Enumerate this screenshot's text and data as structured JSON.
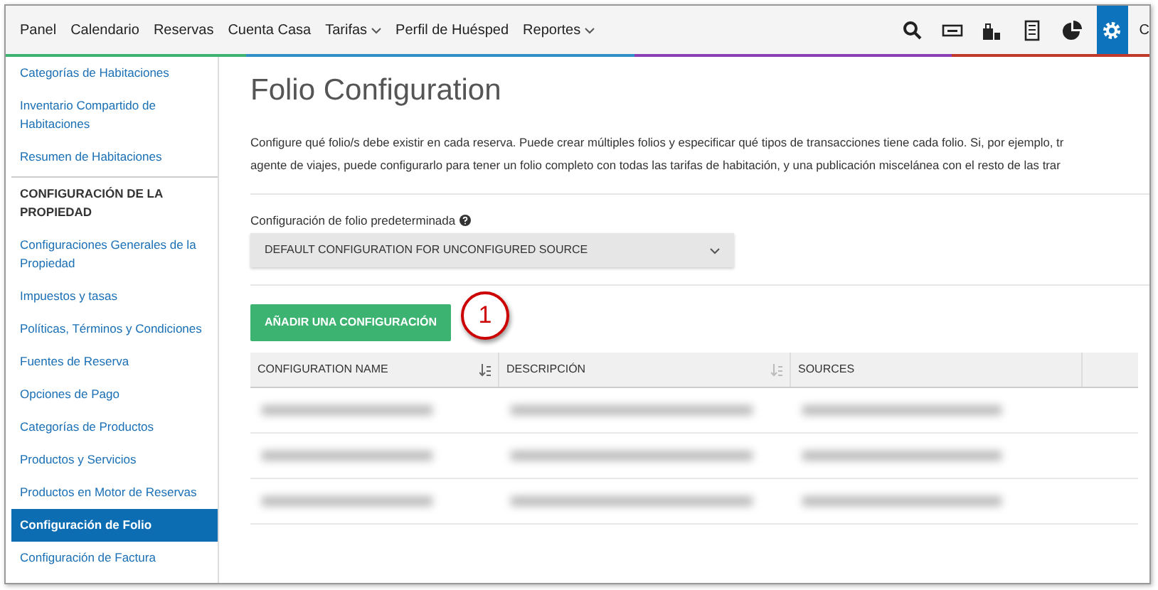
{
  "nav": {
    "items": [
      {
        "label": "Panel",
        "dropdown": false
      },
      {
        "label": "Calendario",
        "dropdown": false
      },
      {
        "label": "Reservas",
        "dropdown": false
      },
      {
        "label": "Cuenta Casa",
        "dropdown": false
      },
      {
        "label": "Tarifas",
        "dropdown": true
      },
      {
        "label": "Perfil de Huésped",
        "dropdown": false
      },
      {
        "label": "Reportes",
        "dropdown": true
      }
    ],
    "icons": [
      {
        "kind": "search",
        "selected": false
      },
      {
        "kind": "card",
        "selected": false
      },
      {
        "kind": "bag",
        "selected": false
      },
      {
        "kind": "grid",
        "selected": false
      },
      {
        "kind": "pie",
        "selected": false
      },
      {
        "kind": "gear",
        "selected": true
      }
    ],
    "cut_label": "C"
  },
  "sidebar": {
    "items": [
      {
        "label": "Categorías de Habitaciones",
        "kind": "link",
        "selected": false
      },
      {
        "label": "Inventario Compartido de Habitaciones",
        "kind": "link",
        "selected": false
      },
      {
        "label": "Resumen de Habitaciones",
        "kind": "link",
        "selected": false
      },
      {
        "label": "CONFIGURACIÓN DE LA PROPIEDAD",
        "kind": "heading",
        "selected": false
      },
      {
        "label": "Configuraciones Generales de la Propiedad",
        "kind": "link",
        "selected": false
      },
      {
        "label": "Impuestos y tasas",
        "kind": "link",
        "selected": false
      },
      {
        "label": "Políticas, Términos y Condiciones",
        "kind": "link",
        "selected": false
      },
      {
        "label": "Fuentes de Reserva",
        "kind": "link",
        "selected": false
      },
      {
        "label": "Opciones de Pago",
        "kind": "link",
        "selected": false
      },
      {
        "label": "Categorías de Productos",
        "kind": "link",
        "selected": false
      },
      {
        "label": "Productos y Servicios",
        "kind": "link",
        "selected": false
      },
      {
        "label": "Productos en Motor de Reservas",
        "kind": "link",
        "selected": false
      },
      {
        "label": "Configuración de Folio",
        "kind": "link",
        "selected": true
      },
      {
        "label": "Configuración de Factura",
        "kind": "link",
        "selected": false
      }
    ]
  },
  "main": {
    "title": "Folio Configuration",
    "description_lines": [
      "Configure qué folio/s debe existir en cada reserva. Puede crear múltiples folios y especificar qué tipos de transacciones tiene cada folio. Si, por ejemplo, tr",
      "agente de viajes, puede configurarlo para tener un folio completo con todas las tarifas de habitación, y una publicación miscelánea con el resto de las trar"
    ],
    "default_select": {
      "label": "Configuración de folio predeterminada",
      "value": "DEFAULT CONFIGURATION FOR UNCONFIGURED SOURCE"
    },
    "add_button": "AÑADIR UNA CONFIGURACIÓN",
    "callout": "1",
    "table": {
      "columns": [
        {
          "label": "CONFIGURATION NAME",
          "sortable": true
        },
        {
          "label": "DESCRIPCIÓN",
          "sortable": true
        },
        {
          "label": "SOURCES",
          "sortable": false
        }
      ],
      "rows": [
        {
          "blurred": true
        },
        {
          "blurred": true
        },
        {
          "blurred": true
        }
      ]
    }
  }
}
